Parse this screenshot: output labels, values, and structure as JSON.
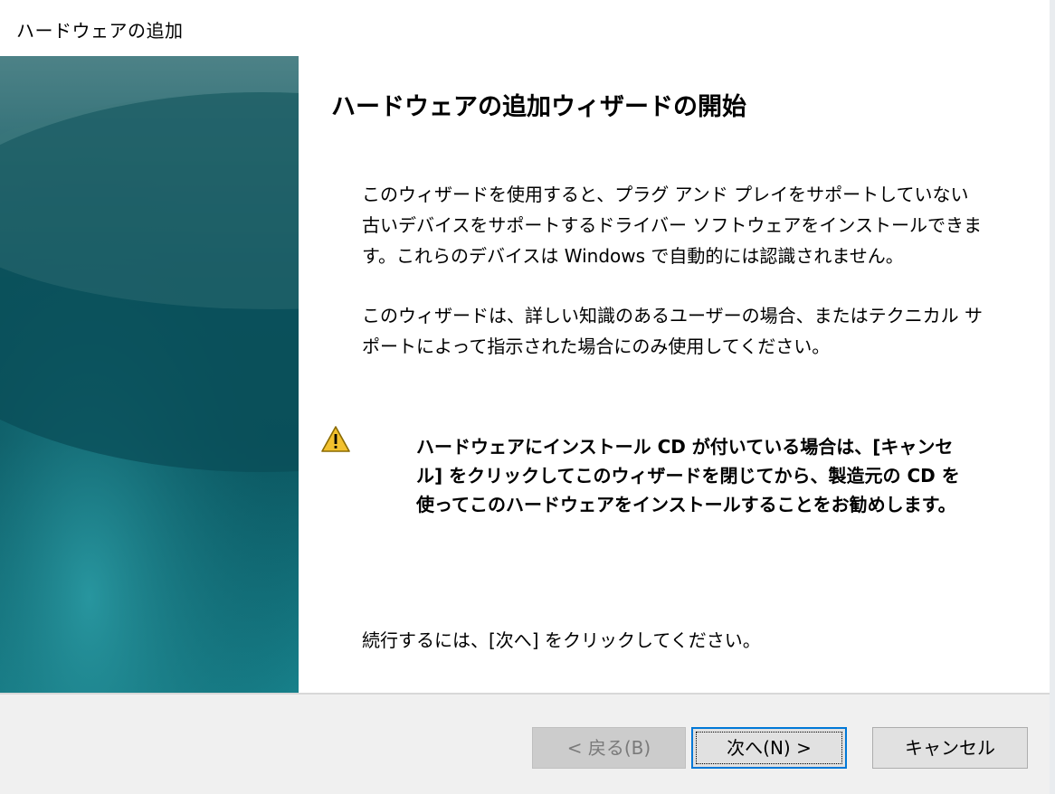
{
  "window": {
    "title": "ハードウェアの追加"
  },
  "wizard": {
    "heading": "ハードウェアの追加ウィザードの開始",
    "paragraph1": "このウィザードを使用すると、プラグ アンド プレイをサポートしていない古いデバイスをサポートするドライバー ソフトウェアをインストールできます。これらのデバイスは Windows で自動的には認識されません。",
    "paragraph2": "このウィザードは、詳しい知識のあるユーザーの場合、またはテクニカル サポートによって指示された場合にのみ使用してください。",
    "warning": "ハードウェアにインストール CD が付いている場合は、[キャンセル] をクリックしてこのウィザードを閉じてから、製造元の CD を使ってこのハードウェアをインストールすることをお勧めします。",
    "continue_text": "続行するには、[次へ] をクリックしてください。",
    "warning_icon": "warning-triangle-icon"
  },
  "buttons": {
    "back_label": "< 戻る(B)",
    "back_enabled": false,
    "next_label": "次へ(N) >",
    "cancel_label": "キャンセル"
  },
  "colors": {
    "side_panel_dark": "#0b5660",
    "side_panel_light": "#4d8287",
    "focus_accent": "#0078d7",
    "warning_yellow": "#f2c12e"
  }
}
